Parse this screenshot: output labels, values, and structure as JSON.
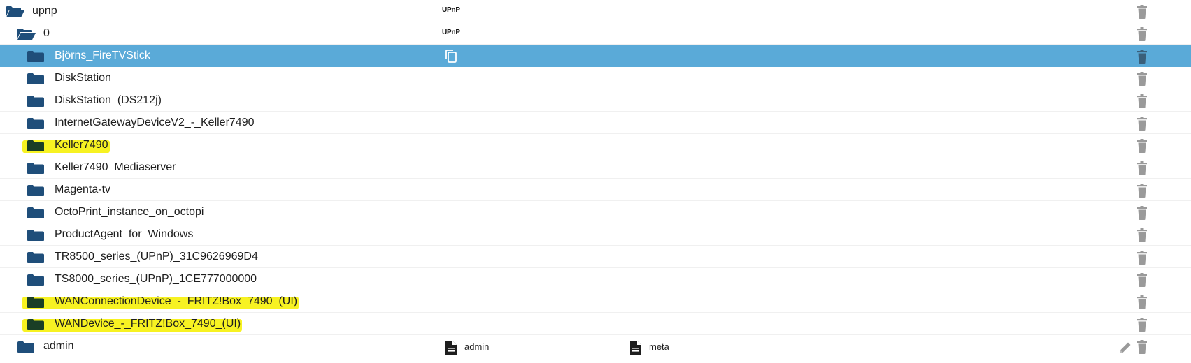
{
  "colors": {
    "folder": "#1f4e7a",
    "selected_bg": "#5aaad8",
    "trash": "#9a9a9a",
    "highlight": "#f7f222"
  },
  "rows": [
    {
      "label": "upnp",
      "open": true,
      "badge": "UPnP"
    },
    {
      "label": "0",
      "open": true,
      "badge": "UPnP"
    },
    {
      "label": "Björns_FireTVStick",
      "selected": true,
      "copy_icon": true
    },
    {
      "label": "DiskStation"
    },
    {
      "label": "DiskStation_(DS212j)"
    },
    {
      "label": "InternetGatewayDeviceV2_-_Keller7490"
    },
    {
      "label": "Keller7490",
      "highlighted": true
    },
    {
      "label": "Keller7490_Mediaserver"
    },
    {
      "label": "Magenta-tv"
    },
    {
      "label": "OctoPrint_instance_on_octopi"
    },
    {
      "label": "ProductAgent_for_Windows"
    },
    {
      "label": "TR8500_series_(UPnP)_31C9626969D4"
    },
    {
      "label": "TS8000_series_(UPnP)_1CE777000000"
    },
    {
      "label": "WANConnectionDevice_-_FRITZ!Box_7490_(UI)",
      "highlighted": true
    },
    {
      "label": "WANDevice_-_FRITZ!Box_7490_(UI)",
      "highlighted": true
    },
    {
      "label": "admin",
      "files": [
        "admin",
        "meta"
      ],
      "edit": true
    }
  ]
}
